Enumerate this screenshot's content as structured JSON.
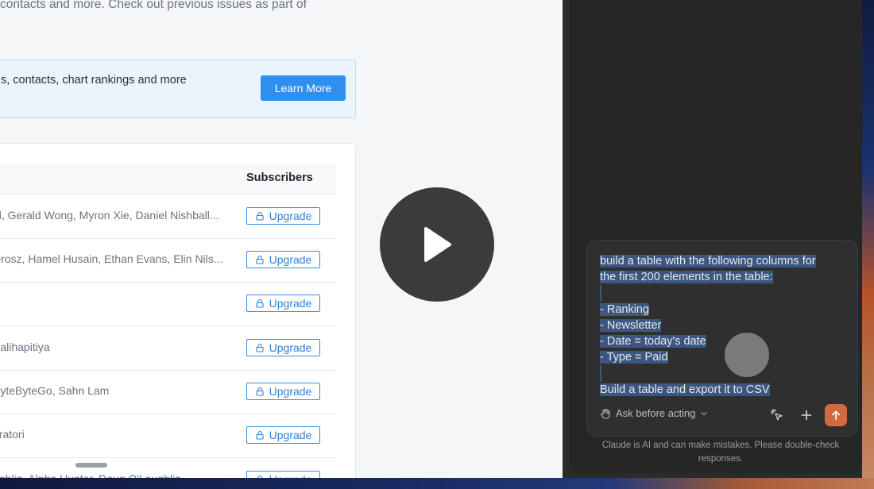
{
  "webpage": {
    "intro": "contacts and more. Check out previous issues as part of",
    "banner": {
      "text": "s, contacts, chart rankings and more",
      "button_label": "Learn More"
    },
    "table": {
      "header_subscribers": "Subscribers",
      "upgrade_label": "Upgrade",
      "rows": [
        "el, Gerald Wong, Myron Xie, Daniel Nishball...",
        "Drosz, Hamel Husain, Ethan Evans, Elin Nils...",
        "",
        "Palihapitiya",
        "ByteByteGo, Sahn Lam",
        "uratori",
        "ughlin, Alpha Hunter, Doug O'Laughlin"
      ]
    }
  },
  "panel": {
    "prompt_lines": [
      "build a table with the following columns for",
      "the first 200 elements in the table:",
      "",
      "- Ranking",
      "- Newsletter",
      "- Date = today's date",
      "- Type = Paid",
      "",
      "Build a table and export it to CSV"
    ],
    "ask_mode_label": "Ask before acting",
    "disclaimer": "Claude is AI and can make mistakes. Please double-check responses."
  },
  "colors": {
    "accent_blue": "#2f8ef0",
    "send_orange": "#d2693f",
    "selection": "#3c5682"
  }
}
